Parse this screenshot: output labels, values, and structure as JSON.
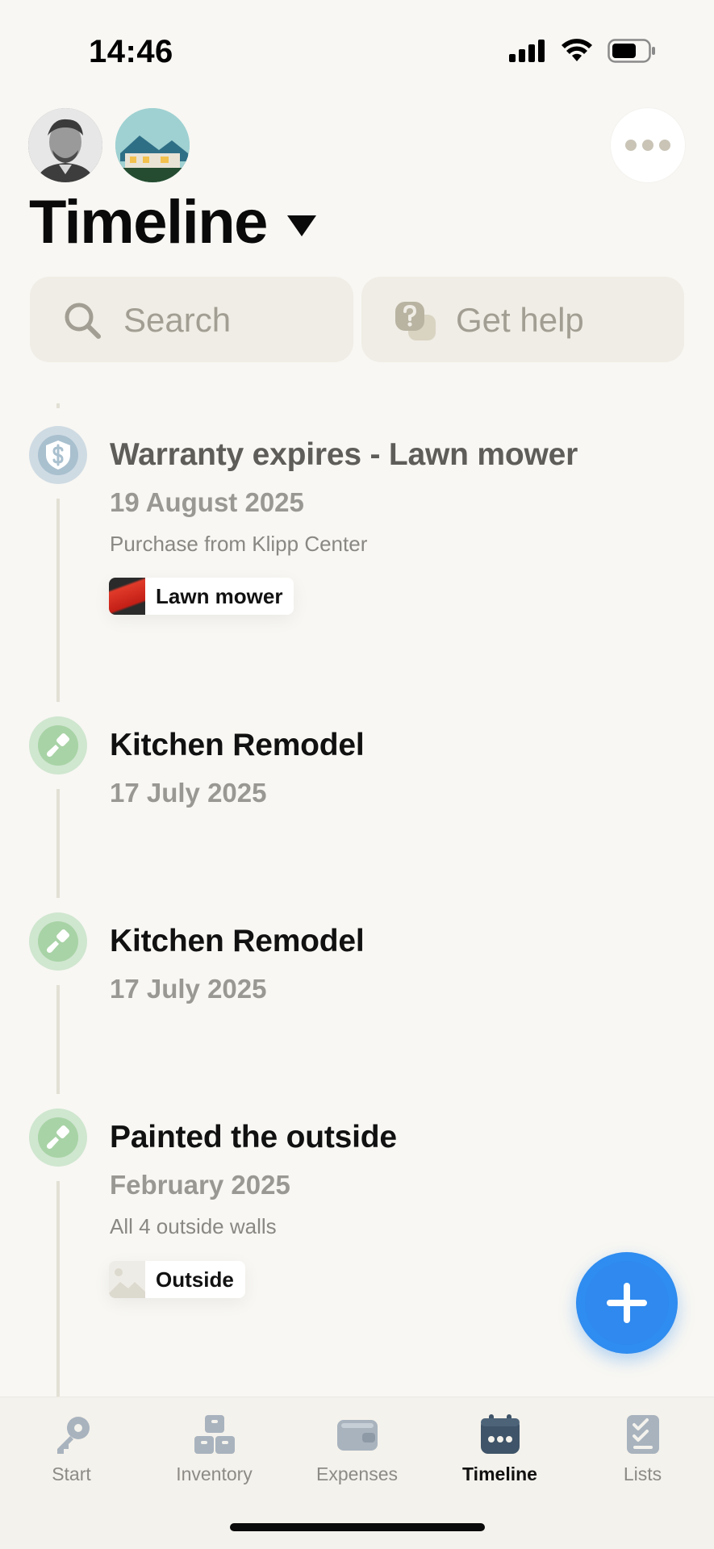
{
  "status_bar": {
    "time": "14:46"
  },
  "header": {
    "title": "Timeline",
    "avatars": [
      "person-avatar",
      "house-avatar"
    ]
  },
  "search": {
    "label": "Search"
  },
  "help": {
    "label": "Get help"
  },
  "entries": [
    {
      "title": "Warranty expires - Lawn mower",
      "date": "19 August 2025",
      "description": "Purchase from Klipp Center",
      "tag": "Lawn mower",
      "icon": "shield-dollar-icon"
    },
    {
      "title": "Kitchen Remodel",
      "date": "17 July 2025",
      "icon": "paintbrush-icon"
    },
    {
      "title": "Kitchen Remodel",
      "date": "17 July 2025",
      "icon": "paintbrush-icon"
    },
    {
      "title": "Painted the outside",
      "date": "February 2025",
      "description": "All 4 outside walls",
      "tag": "Outside",
      "icon": "paintbrush-icon"
    }
  ],
  "tabs": [
    {
      "label": "Start",
      "icon": "key-icon"
    },
    {
      "label": "Inventory",
      "icon": "boxes-icon"
    },
    {
      "label": "Expenses",
      "icon": "wallet-icon"
    },
    {
      "label": "Timeline",
      "icon": "calendar-icon",
      "active": true
    },
    {
      "label": "Lists",
      "icon": "checklist-icon"
    }
  ],
  "colors": {
    "background": "#f8f7f3",
    "accent_blue": "#2f8cf0",
    "green_node": "#a8d3a6",
    "shield_node": "#a9c0cf",
    "tab_active": "#3f5468",
    "tab_inactive": "#a8b3be"
  }
}
